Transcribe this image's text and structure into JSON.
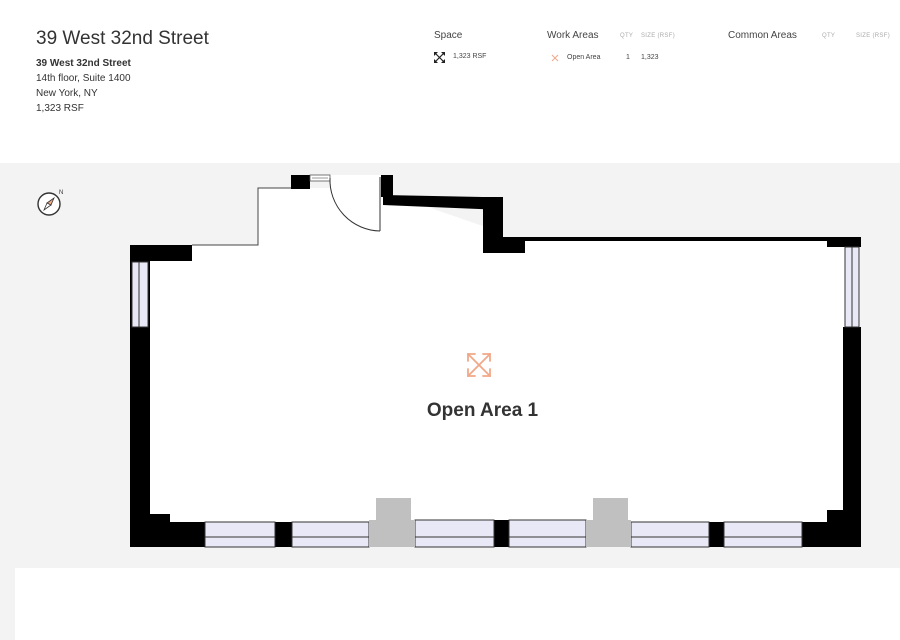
{
  "header": {
    "title": "39 West 32nd Street",
    "address": {
      "name": "39 West 32nd Street",
      "suite": "14th floor, Suite 1400",
      "city": "New York, NY",
      "size": "1,323 RSF"
    }
  },
  "summary": {
    "space": {
      "label": "Space",
      "icon": "expand-arrows-icon",
      "value": "1,323 RSF"
    },
    "work_areas": {
      "label": "Work Areas",
      "col_qty": "QTY",
      "col_size": "SIZE (RSF)",
      "rows": [
        {
          "icon": "open-area-icon",
          "name": "Open Area",
          "qty": "1",
          "size": "1,323"
        }
      ]
    },
    "common_areas": {
      "label": "Common Areas",
      "col_qty": "QTY",
      "col_size": "SIZE (RSF)"
    }
  },
  "plan": {
    "area_label": "Open Area 1",
    "compass_label": "N",
    "colors": {
      "wall": "#000000",
      "floor": "#ffffff",
      "background": "#f3f3f3",
      "window": "#e8e8f6",
      "column": "#c0c0c0",
      "accent": "#f0a888"
    }
  }
}
